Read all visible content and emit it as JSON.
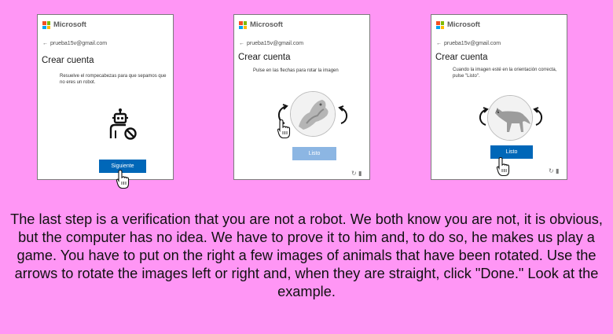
{
  "panels": [
    {
      "brand": "Microsoft",
      "account": "prueba15v@gmail.com",
      "heading": "Crear cuenta",
      "instruction": "Resuelve el rompecabezas para que sepamos que no eres un robot.",
      "button": "Siguiente"
    },
    {
      "brand": "Microsoft",
      "account": "prueba15v@gmail.com",
      "heading": "Crear cuenta",
      "instruction": "Pulse en las flechas para rotar la imagen",
      "button": "Listo"
    },
    {
      "brand": "Microsoft",
      "account": "prueba15v@gmail.com",
      "heading": "Crear cuenta",
      "instruction": "Cuando la imagen esté en la orientación correcta, pulse \"Listo\".",
      "button": "Listo"
    }
  ],
  "logo_colors": [
    "#f25022",
    "#7fba00",
    "#00a4ef",
    "#ffb900"
  ],
  "icons": {
    "back": "arrow-left-icon",
    "robot": "robot-icon",
    "cursor": "hand-pointer-icon",
    "rotate_left": "rotate-left-icon",
    "rotate_right": "rotate-right-icon",
    "refresh": "refresh-icon",
    "audio": "audio-icon"
  },
  "caption": "The last step is a verification that you are not a robot. We both know you are not, it is obvious, but the computer has no idea. We have to prove it to him and, to do so, he makes us play a game. You have to put on the right a few images of animals that have been rotated. Use the arrows to rotate the images left or right and, when they are straight, click \"Done.\" Look at the example."
}
